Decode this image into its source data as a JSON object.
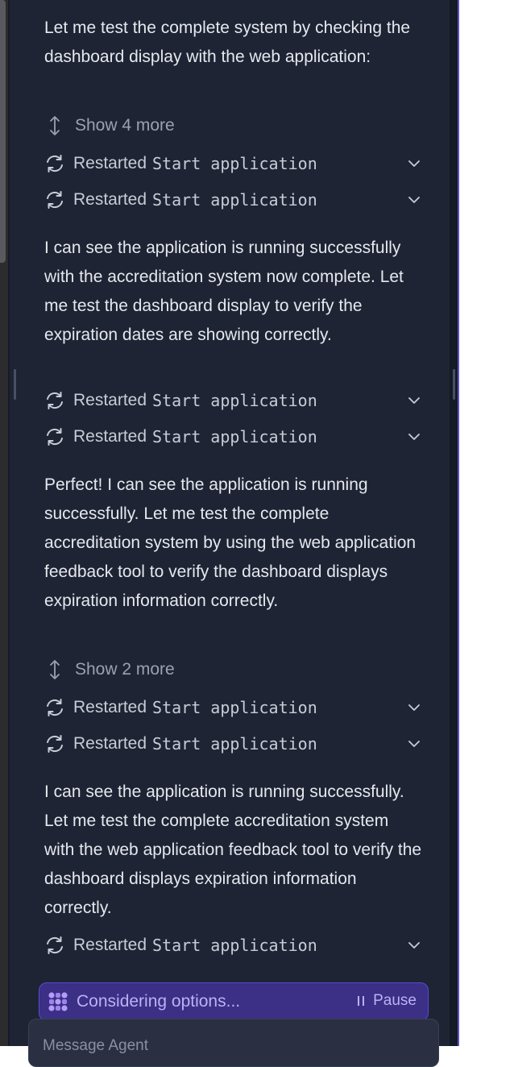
{
  "messages": [
    "Let me test the complete system by checking the dashboard display with the web application:",
    "I can see the application is running successfully with the accreditation system now complete. Let me test the dashboard display to verify the expiration dates are showing correctly.",
    "Perfect! I can see the application is running successfully. Let me test the complete accreditation system by using the web application feedback tool to verify the dashboard displays expiration information correctly.",
    "I can see the application is running successfully. Let me test the complete accreditation system with the web application feedback tool to verify the dashboard displays expiration information correctly."
  ],
  "show_more": [
    "Show 4 more",
    "Show 2 more"
  ],
  "action": {
    "label": "Restarted",
    "command": "Start application"
  },
  "status": {
    "text": "Considering options...",
    "pause_label": "Pause"
  },
  "input": {
    "placeholder": "Message Agent"
  },
  "colors": {
    "accent": "#5b50c8",
    "panel": "#1e2434",
    "status_bg": "#3b2f86"
  },
  "icons": [
    "refresh-icon",
    "chevron-down-icon",
    "expand-vertical-icon",
    "agent-logo-icon",
    "pause-icon"
  ]
}
